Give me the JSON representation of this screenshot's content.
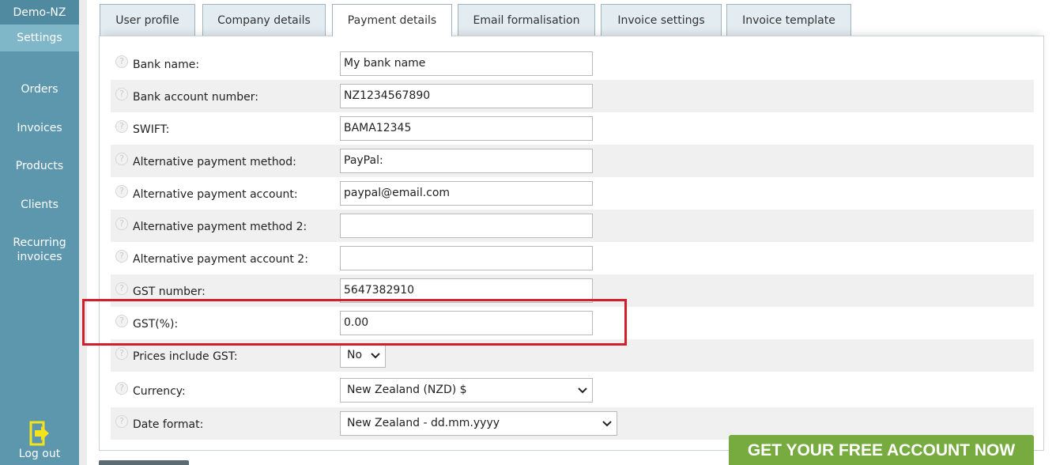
{
  "sidebar": {
    "brand": "Demo-NZ",
    "active": "Settings",
    "items": [
      "Orders",
      "Invoices",
      "Products",
      "Clients"
    ],
    "recurring": [
      "Recurring",
      "invoices"
    ],
    "logout": "Log out"
  },
  "tabs": [
    "User profile",
    "Company details",
    "Payment details",
    "Email formalisation",
    "Invoice settings",
    "Invoice template"
  ],
  "form": {
    "bank_name": {
      "label": "Bank name:",
      "value": "My bank name"
    },
    "bank_account": {
      "label": "Bank account number:",
      "value": "NZ1234567890"
    },
    "swift": {
      "label": "SWIFT:",
      "value": "BAMA12345"
    },
    "alt_method": {
      "label": "Alternative payment method:",
      "value": "PayPal:"
    },
    "alt_account": {
      "label": "Alternative payment account:",
      "value": "paypal@email.com"
    },
    "alt_method2": {
      "label": "Alternative payment method 2:",
      "value": ""
    },
    "alt_account2": {
      "label": "Alternative payment account 2:",
      "value": ""
    },
    "gst_number": {
      "label": "GST number:",
      "value": "5647382910"
    },
    "gst_percent": {
      "label": "GST(%):",
      "value": "0.00"
    },
    "prices_include_gst": {
      "label": "Prices include GST:",
      "value": "No"
    },
    "currency": {
      "label": "Currency:",
      "value": "New Zealand (NZD) $"
    },
    "date_format": {
      "label": "Date format:",
      "value": "New Zealand - dd.mm.yyyy"
    }
  },
  "help_glyph": "?",
  "cta": "GET YOUR FREE ACCOUNT NOW",
  "colors": {
    "sidebar": "#5d97ad",
    "highlight": "#d21f2b",
    "cta": "#77ab3f"
  }
}
